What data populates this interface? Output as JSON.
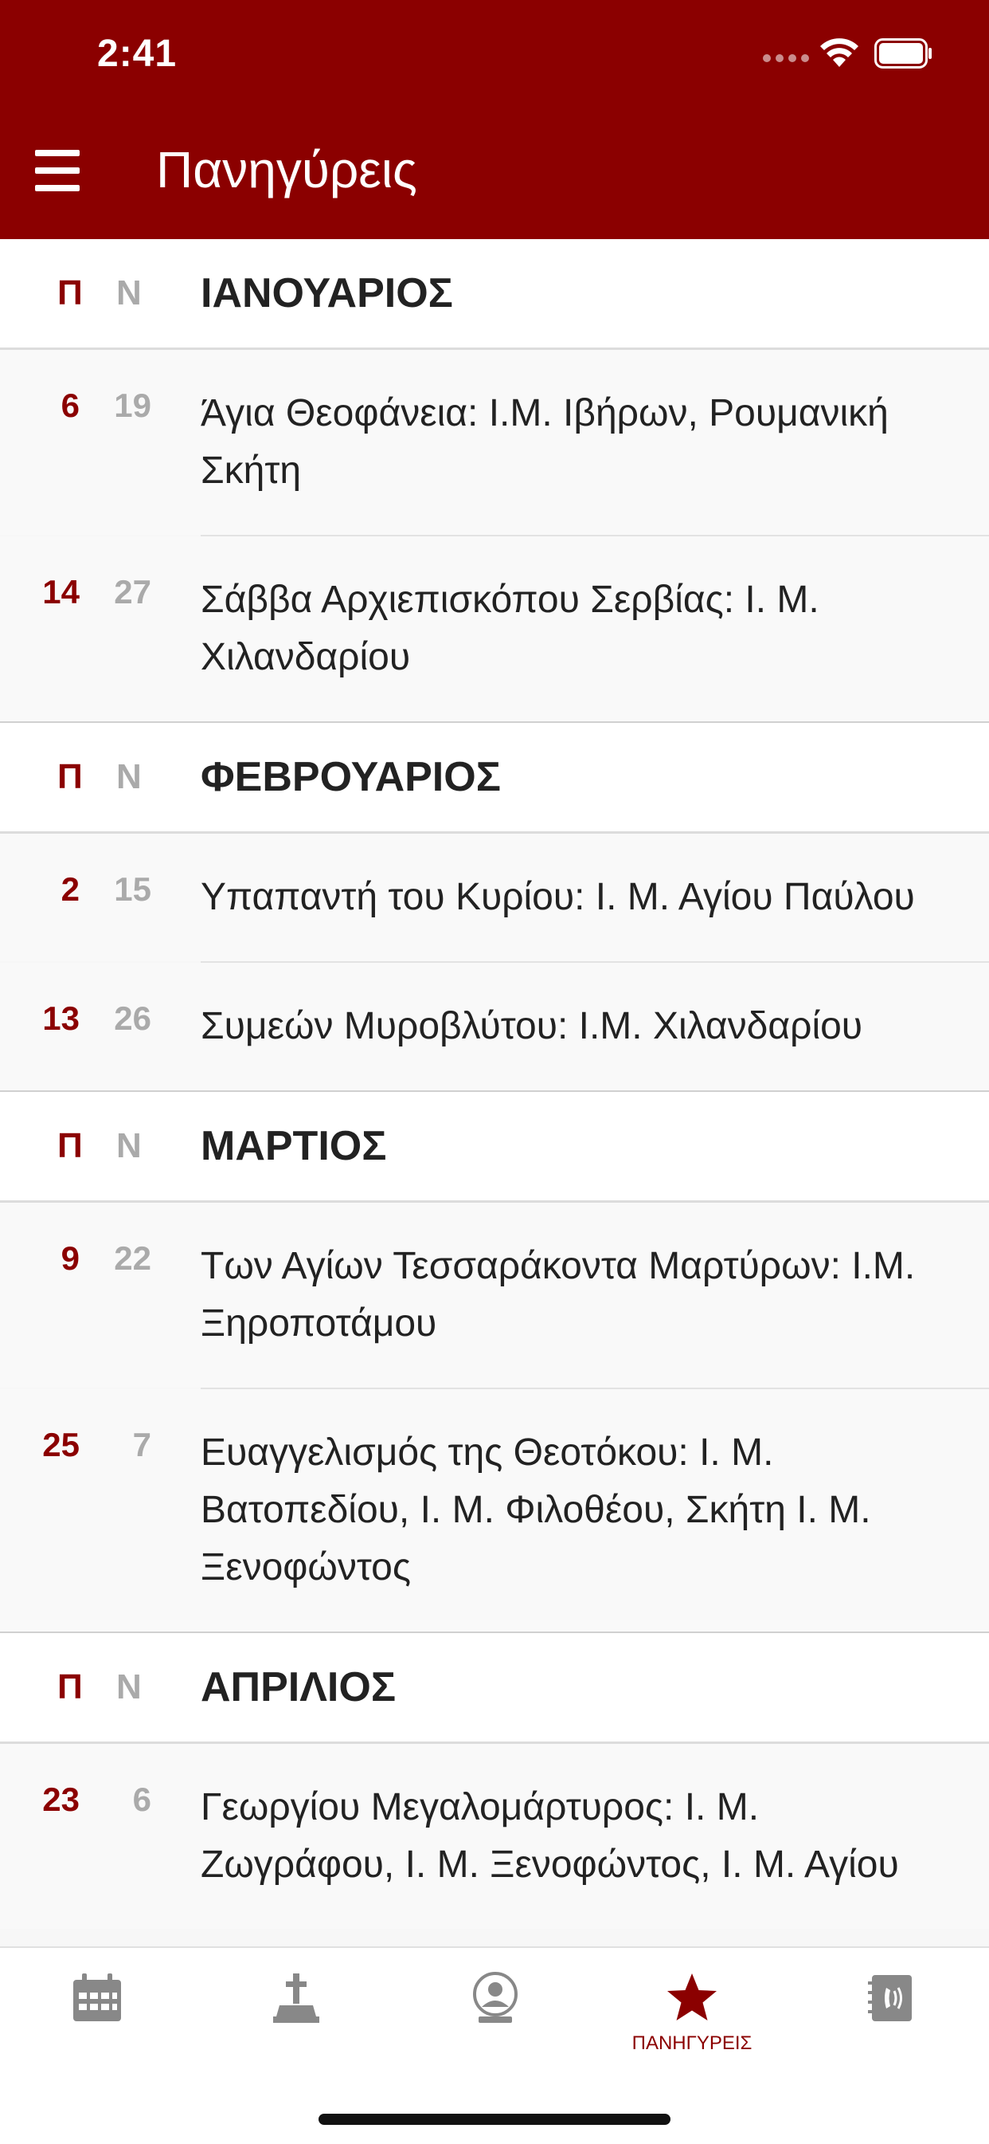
{
  "status_bar": {
    "time": "2:41"
  },
  "header": {
    "title": "Πανηγύρεις"
  },
  "column_labels": {
    "p": "Π",
    "n": "Ν"
  },
  "months": [
    {
      "name": "ΙΑΝΟΥΑΡΙΟΣ",
      "items": [
        {
          "p": "6",
          "n": "19",
          "text": "Άγια Θεοφάνεια: Ι.Μ. Ιβήρων, Ρουμανική Σκήτη"
        },
        {
          "p": "14",
          "n": "27",
          "text": "Σάββα Αρχιεπισκόπου Σερβίας: Ι. Μ. Χιλανδαρίου"
        }
      ]
    },
    {
      "name": "ΦΕΒΡΟΥΑΡΙΟΣ",
      "items": [
        {
          "p": "2",
          "n": "15",
          "text": "Υπαπαντή του Κυρίου: Ι. Μ. Αγίου Παύλου"
        },
        {
          "p": "13",
          "n": "26",
          "text": "Συμεών Μυροβλύτου: Ι.Μ. Χιλανδαρίου"
        }
      ]
    },
    {
      "name": "ΜΑΡΤΙΟΣ",
      "items": [
        {
          "p": "9",
          "n": "22",
          "text": "Των Αγίων Τεσσαράκοντα Μαρτύρων: Ι.Μ. Ξηροποτάμου"
        },
        {
          "p": "25",
          "n": "7",
          "text": "Ευαγγελισμός της Θεοτόκου: Ι. Μ. Βατοπεδίου, Ι. Μ. Φιλοθέου, Σκήτη Ι. Μ. Ξενοφώντος"
        }
      ]
    },
    {
      "name": "ΑΠΡΙΛΙΟΣ",
      "items": [
        {
          "p": "23",
          "n": "6",
          "text": "Γεωργίου Μεγαλομάρτυρος: Ι. Μ. Ζωγράφου, Ι. Μ. Ξενοφώντος, Ι. Μ. Αγίου"
        }
      ]
    }
  ],
  "tabbar": {
    "tabs": [
      {
        "icon": "calendar-icon",
        "label": ""
      },
      {
        "icon": "saint-icon",
        "label": ""
      },
      {
        "icon": "person-icon",
        "label": ""
      },
      {
        "icon": "star-icon",
        "label": "ΠΑΝΗΓΥΡΕΙΣ",
        "active": true
      },
      {
        "icon": "contacts-icon",
        "label": ""
      }
    ]
  },
  "colors": {
    "accent": "#8b0000",
    "muted": "#aaaaaa",
    "tab_inactive": "#888888"
  }
}
